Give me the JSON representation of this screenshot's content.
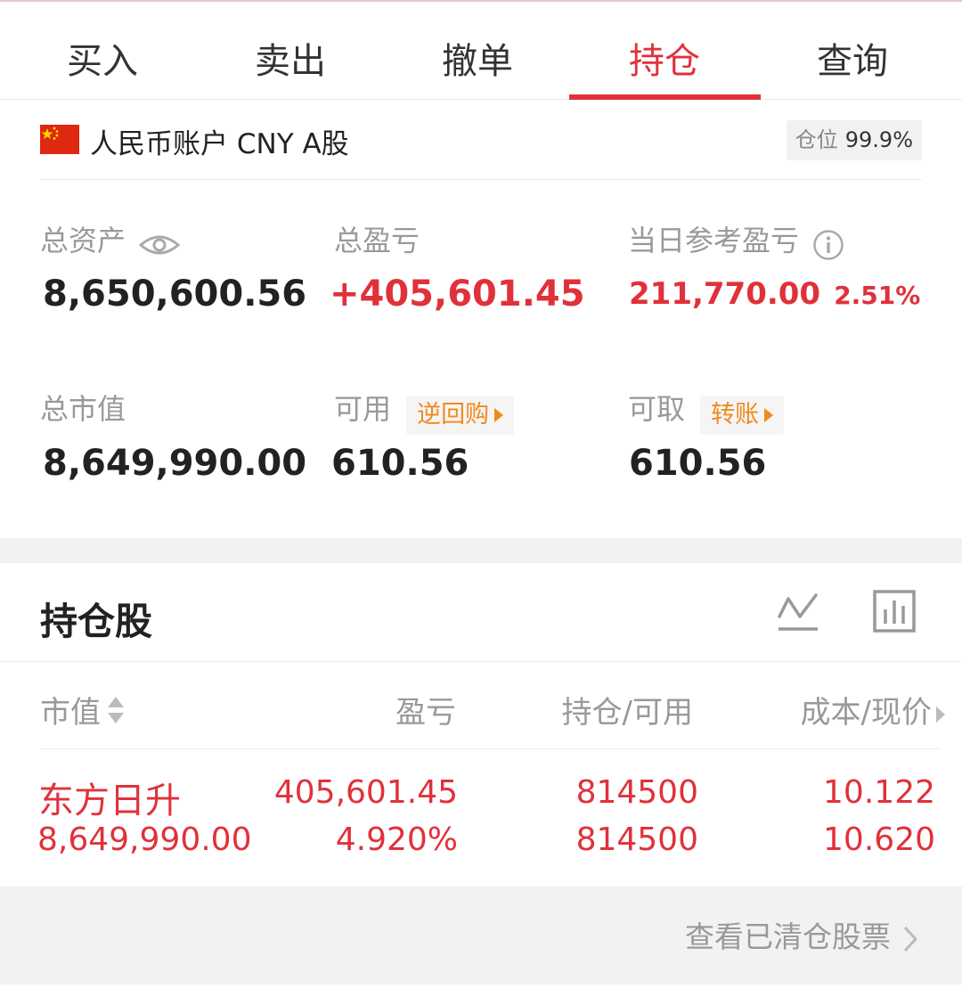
{
  "tabs": [
    {
      "label": "买入"
    },
    {
      "label": "卖出"
    },
    {
      "label": "撤单"
    },
    {
      "label": "持仓"
    },
    {
      "label": "查询"
    }
  ],
  "active_tab": "持仓",
  "account": {
    "name": "人民币账户 CNY A股",
    "position_label": "仓位",
    "position_value": "99.9%"
  },
  "summary": {
    "total_assets_label": "总资产",
    "total_assets": "8,650,600.56",
    "total_pnl_label": "总盈亏",
    "total_pnl": "+405,601.45",
    "daily_pnl_label": "当日参考盈亏",
    "daily_pnl": "211,770.00",
    "daily_pnl_pct": "2.51%",
    "market_value_label": "总市值",
    "market_value": "8,649,990.00",
    "available_label": "可用",
    "available_pill": "逆回购",
    "available": "610.56",
    "withdrawable_label": "可取",
    "withdrawable_pill": "转账",
    "withdrawable": "610.56"
  },
  "holdings": {
    "title": "持仓股",
    "columns": {
      "market_value": "市值",
      "pnl": "盈亏",
      "position": "持仓/可用",
      "cost": "成本/现价"
    },
    "rows": [
      {
        "name": "东方日升",
        "market_value": "8,649,990.00",
        "pnl": "405,601.45",
        "pnl_pct": "4.920%",
        "position": "814500",
        "available": "814500",
        "cost": "10.122",
        "price": "10.620"
      }
    ],
    "footer_link": "查看已清仓股票"
  },
  "colors": {
    "accent": "#e0313a",
    "orange": "#f08a1c",
    "gray_text": "#999999"
  }
}
